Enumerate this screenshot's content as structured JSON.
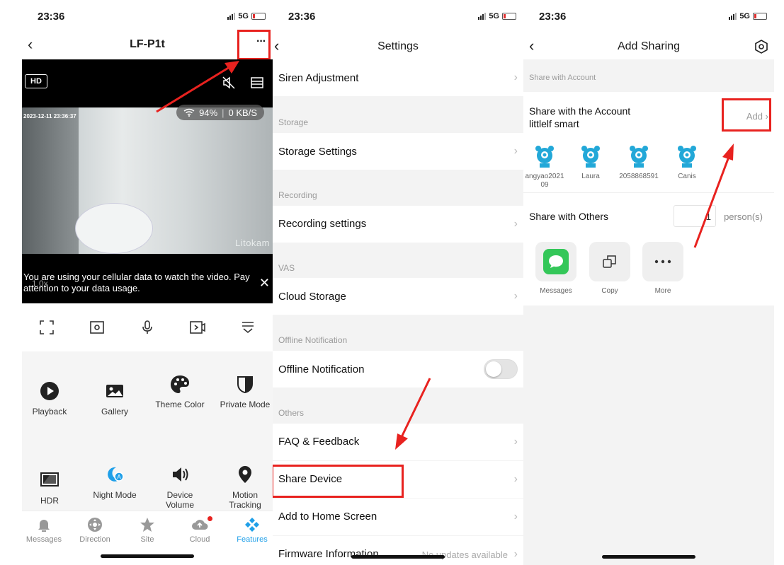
{
  "status_bar": {
    "time": "23:36",
    "network": "5G"
  },
  "panel1": {
    "title": "LF-P1t",
    "more_label": "···",
    "hd_label": "HD",
    "video_timestamp": "2023-12-11 23:36:37",
    "wifi_strength": "94%",
    "bitrate": "0 KB/S",
    "watermark": "Litokam",
    "zoom_level": "1.0x",
    "data_notice": "You are using your cellular data to watch the video. Pay attention to your data usage.",
    "features": [
      {
        "label": "Playback",
        "icon": "play-icon"
      },
      {
        "label": "Gallery",
        "icon": "image-icon"
      },
      {
        "label": "Theme Color",
        "icon": "palette-icon"
      },
      {
        "label": "Private Mode",
        "icon": "shield-icon"
      },
      {
        "label": "HDR",
        "icon": "hdr-icon"
      },
      {
        "label": "Night Mode",
        "icon": "night-mode-icon"
      },
      {
        "label": "Device Volume",
        "icon": "speaker-icon"
      },
      {
        "label": "Motion Tracking",
        "icon": "location-pin-icon"
      }
    ],
    "tabs": [
      {
        "label": "Messages",
        "icon": "bell-icon"
      },
      {
        "label": "Direction",
        "icon": "direction-pad-icon"
      },
      {
        "label": "Site",
        "icon": "star-icon"
      },
      {
        "label": "Cloud",
        "icon": "cloud-upload-icon"
      },
      {
        "label": "Features",
        "icon": "features-icon",
        "active": true
      }
    ],
    "accent_color": "#1f9fe8",
    "badge_color": "#e8221f"
  },
  "panel2": {
    "title": "Settings",
    "siren": "Siren Adjustment",
    "section_storage": "Storage",
    "storage_settings": "Storage Settings",
    "section_recording": "Recording",
    "recording_settings": "Recording settings",
    "section_vas": "VAS",
    "cloud_storage": "Cloud Storage",
    "section_offline": "Offline Notification",
    "offline_notification": "Offline Notification",
    "offline_toggle_on": false,
    "section_others": "Others",
    "faq": "FAQ & Feedback",
    "share_device": "Share Device",
    "add_home": "Add to Home Screen",
    "firmware": "Firmware Information",
    "firmware_status": "No updates available"
  },
  "panel3": {
    "title": "Add Sharing",
    "section_account": "Share with Account",
    "share_account_line1": "Share with the Account",
    "share_account_line2": "littlelf smart",
    "add_label": "Add",
    "people": [
      {
        "name": "angyao2021\n09"
      },
      {
        "name": "Laura"
      },
      {
        "name": "2058868591"
      },
      {
        "name": "Canis"
      }
    ],
    "share_others": "Share with Others",
    "person_count": "1",
    "person_unit": "person(s)",
    "share_actions": [
      {
        "label": "Messages",
        "icon": "messages-icon"
      },
      {
        "label": "Copy",
        "icon": "copy-icon"
      },
      {
        "label": "More",
        "icon": "more-dots-icon"
      }
    ]
  }
}
